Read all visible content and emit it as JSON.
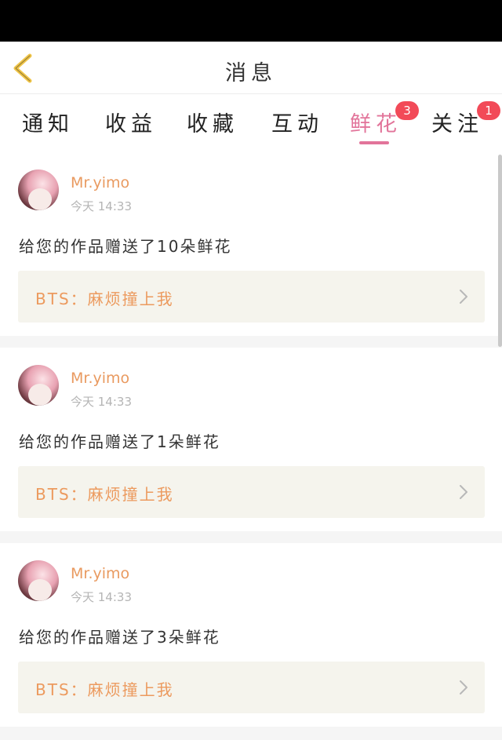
{
  "header": {
    "title": "消息"
  },
  "tabs": [
    {
      "label": "通知"
    },
    {
      "label": "收益"
    },
    {
      "label": "收藏"
    },
    {
      "label": "互动"
    },
    {
      "label": "鲜花",
      "badge": "3",
      "active": true
    },
    {
      "label": "关注",
      "badge": "1"
    }
  ],
  "messages": [
    {
      "user": "Mr.yimo",
      "time": "今天 14:33",
      "text": "给您的作品赠送了10朵鲜花",
      "work": "BTS：麻烦撞上我"
    },
    {
      "user": "Mr.yimo",
      "time": "今天 14:33",
      "text": "给您的作品赠送了1朵鲜花",
      "work": "BTS：麻烦撞上我"
    },
    {
      "user": "Mr.yimo",
      "time": "今天 14:33",
      "text": "给您的作品赠送了3朵鲜花",
      "work": "BTS：麻烦撞上我"
    }
  ],
  "colors": {
    "accent": "#e2749a",
    "username": "#e99a60",
    "badge": "#f24a58",
    "back_arrow": "#f0c548"
  }
}
